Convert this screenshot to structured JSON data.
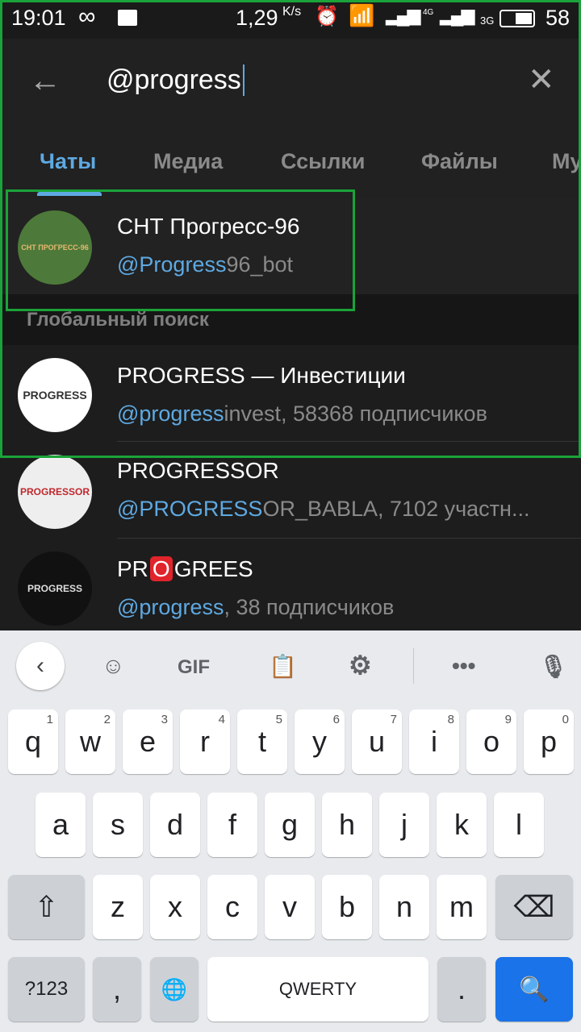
{
  "status": {
    "time": "19:01",
    "speed": "1,29",
    "speed_unit": "K/s",
    "battery": "58",
    "net1": "4G",
    "net2": "3G"
  },
  "search": {
    "value": "@progress"
  },
  "tabs": [
    "Чаты",
    "Медиа",
    "Ссылки",
    "Файлы",
    "Му"
  ],
  "local_results": [
    {
      "title": "СНТ Прогресс-96",
      "sub_hl": "@Progress",
      "sub_rest": "96_bot",
      "avatar_text": "СНТ ПРОГРЕСС-96"
    }
  ],
  "section_header": "Глобальный поиск",
  "global_results": [
    {
      "title": "PROGRESS — Инвестиции",
      "sub_hl": "@progress",
      "sub_rest": "invest, 58368 подписчиков",
      "avatar_text": "PROGRESS"
    },
    {
      "title": "PROGRESSOR",
      "sub_hl": "@PROGRESS",
      "sub_rest": "OR_BABLA, 7102 участн...",
      "avatar_text": "PROGRESSOR"
    },
    {
      "title_a": "PR",
      "title_o": "O",
      "title_b": "GREES",
      "sub_hl": "@progress",
      "sub_rest": ", 38 подписчиков",
      "avatar_text": "PROGRESS"
    }
  ],
  "keyboard": {
    "toolbar": {
      "gif": "GIF"
    },
    "row1": [
      [
        "q",
        "1"
      ],
      [
        "w",
        "2"
      ],
      [
        "e",
        "3"
      ],
      [
        "r",
        "4"
      ],
      [
        "t",
        "5"
      ],
      [
        "y",
        "6"
      ],
      [
        "u",
        "7"
      ],
      [
        "i",
        "8"
      ],
      [
        "o",
        "9"
      ],
      [
        "p",
        "0"
      ]
    ],
    "row2": [
      "a",
      "s",
      "d",
      "f",
      "g",
      "h",
      "j",
      "k",
      "l"
    ],
    "row3": [
      "z",
      "x",
      "c",
      "v",
      "b",
      "n",
      "m"
    ],
    "symbols": "?123",
    "comma": ",",
    "space": "QWERTY",
    "period": ".",
    "search_color": "#1a73e8"
  },
  "colors": {
    "accent": "#5ea9e2",
    "highlight_box": "#1aa33a"
  }
}
